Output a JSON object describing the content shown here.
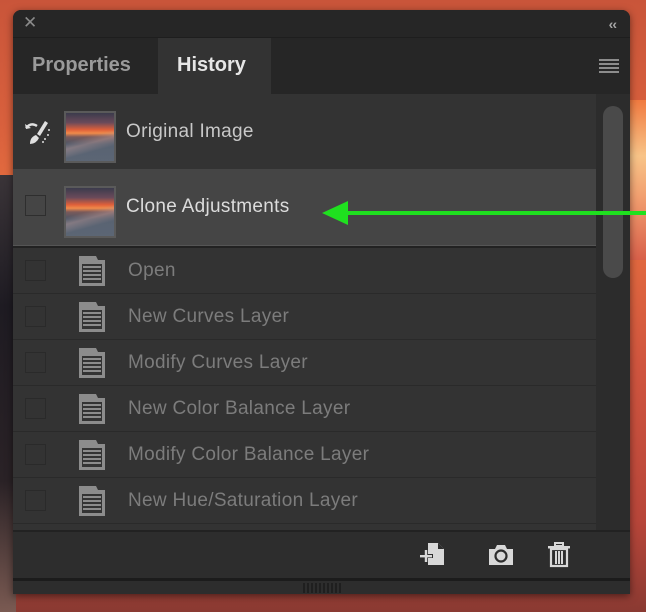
{
  "panel": {
    "close_icon": "close-x-icon",
    "collapse_label": "‹‹",
    "menu_icon": "hamburger-menu-icon"
  },
  "tabs": [
    {
      "label": "Properties",
      "active": false
    },
    {
      "label": "History",
      "active": true
    }
  ],
  "snapshots": [
    {
      "label": "Original Image",
      "icon": "history-brush-icon",
      "selected": false
    },
    {
      "label": "Clone Adjustments",
      "icon": "checkbox",
      "selected": true
    }
  ],
  "states": [
    {
      "label": "Open",
      "icon": "document-icon"
    },
    {
      "label": "New Curves Layer",
      "icon": "document-icon"
    },
    {
      "label": "Modify Curves Layer",
      "icon": "document-icon"
    },
    {
      "label": "New Color Balance Layer",
      "icon": "document-icon"
    },
    {
      "label": "Modify Color Balance Layer",
      "icon": "document-icon"
    },
    {
      "label": "New Hue/Saturation Layer",
      "icon": "document-icon"
    }
  ],
  "footer": {
    "buttons": [
      {
        "name": "new-document-from-state",
        "icon": "new-document-icon"
      },
      {
        "name": "create-snapshot",
        "icon": "camera-icon"
      },
      {
        "name": "delete-state",
        "icon": "trash-icon"
      }
    ]
  },
  "annotation": {
    "arrow_color": "#1fe01f",
    "points_to": "Clone Adjustments"
  },
  "colors": {
    "panel_bg": "#262626",
    "list_bg": "#333333",
    "selected_row_bg": "#454545",
    "active_tab_text": "#e6e6e6",
    "inactive_tab_text": "#9a9a9a",
    "state_text": "#7c7c7c"
  }
}
